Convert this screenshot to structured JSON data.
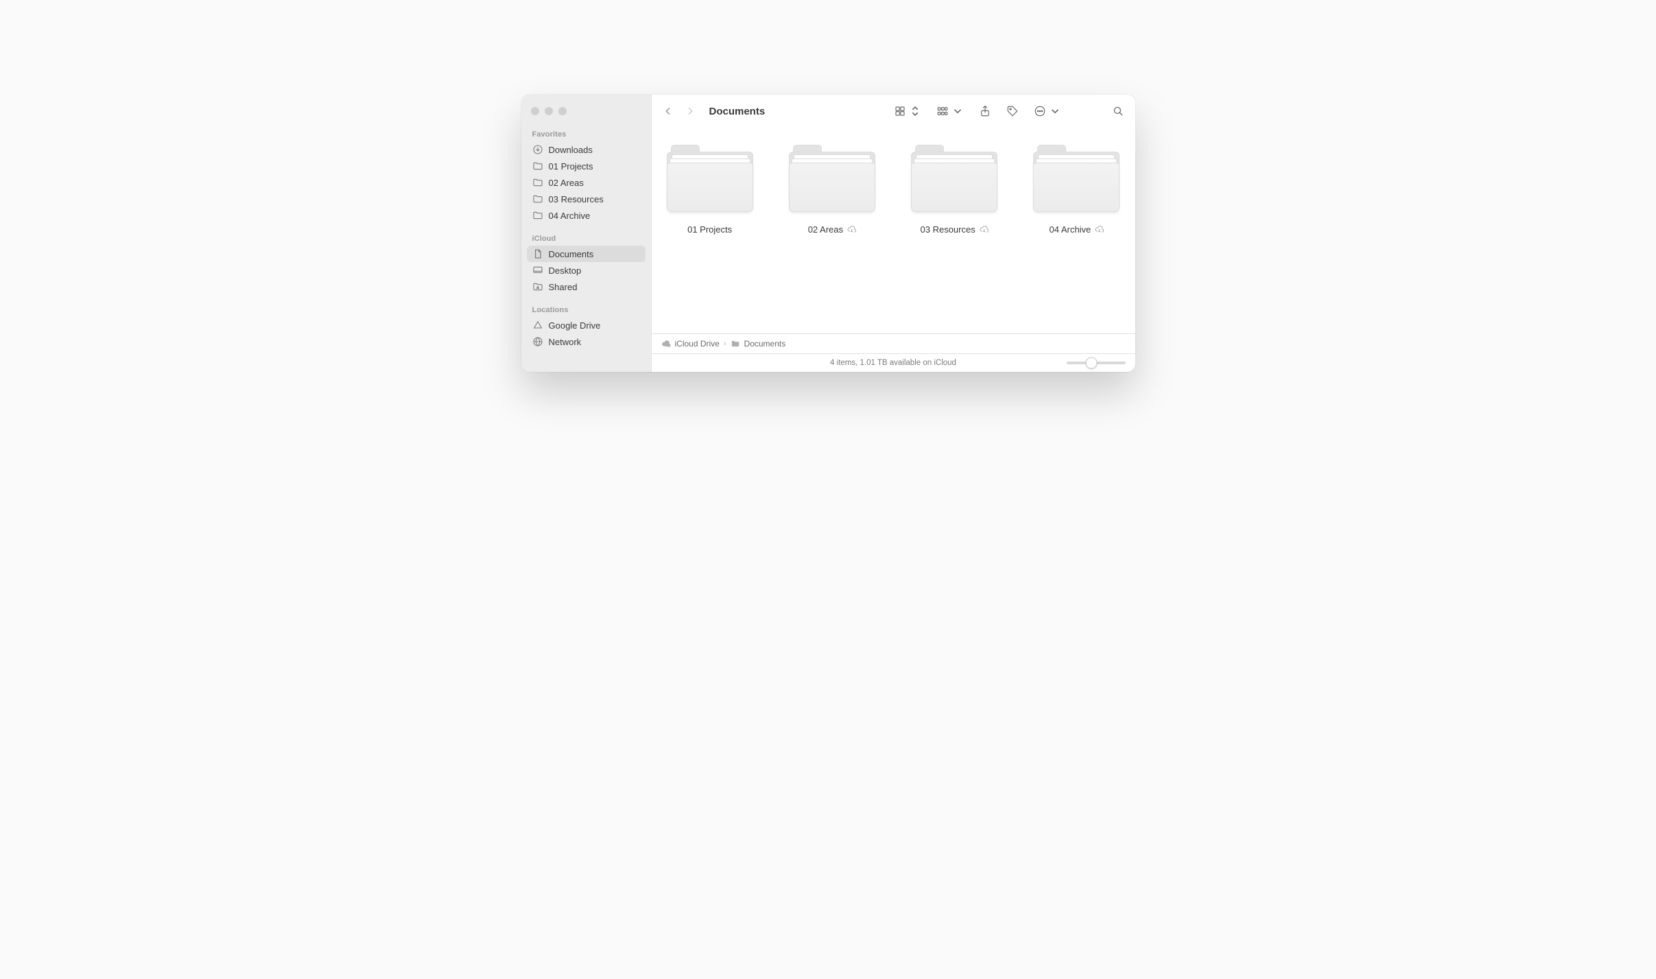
{
  "window_title": "Documents",
  "sidebar": {
    "favorites": {
      "title": "Favorites",
      "items": [
        {
          "label": "Downloads",
          "icon": "download"
        },
        {
          "label": "01 Projects",
          "icon": "folder"
        },
        {
          "label": "02 Areas",
          "icon": "folder"
        },
        {
          "label": "03 Resources",
          "icon": "folder"
        },
        {
          "label": "04 Archive",
          "icon": "folder"
        }
      ]
    },
    "icloud": {
      "title": "iCloud",
      "items": [
        {
          "label": "Documents",
          "icon": "document",
          "selected": true
        },
        {
          "label": "Desktop",
          "icon": "desktop"
        },
        {
          "label": "Shared",
          "icon": "shared-folder"
        }
      ]
    },
    "locations": {
      "title": "Locations",
      "items": [
        {
          "label": "Google Drive",
          "icon": "triangle"
        },
        {
          "label": "Network",
          "icon": "globe"
        }
      ]
    }
  },
  "folders": [
    {
      "name": "01 Projects",
      "cloud": false
    },
    {
      "name": "02 Areas",
      "cloud": true
    },
    {
      "name": "03 Resources",
      "cloud": true
    },
    {
      "name": "04 Archive",
      "cloud": true
    }
  ],
  "path": {
    "root": "iCloud Drive",
    "current": "Documents"
  },
  "status": "4 items, 1.01 TB available on iCloud"
}
